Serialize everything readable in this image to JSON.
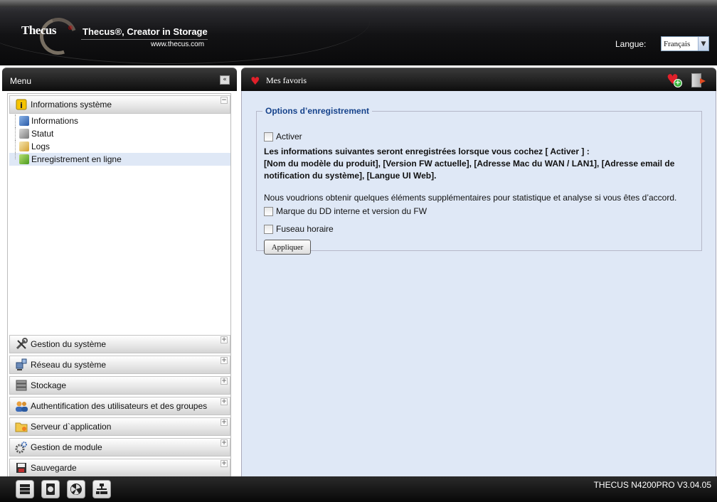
{
  "header": {
    "logo_text": "Thecus",
    "logo_reg": "®",
    "tagline": "Thecus®, Creator in Storage",
    "website": "www.thecus.com",
    "language_label": "Langue:",
    "language_value": "Français"
  },
  "menu": {
    "title": "Menu",
    "collapse_label": "«",
    "expanded_section": {
      "label": "Informations système",
      "toggle": "−",
      "items": [
        {
          "label": "Informations"
        },
        {
          "label": "Statut"
        },
        {
          "label": "Logs"
        },
        {
          "label": "Enregistrement en ligne",
          "selected": true
        }
      ]
    },
    "sections": [
      {
        "label": "Gestion du système",
        "toggle": "+",
        "icon": "tools-icon"
      },
      {
        "label": "Réseau du système",
        "toggle": "+",
        "icon": "network-icon"
      },
      {
        "label": "Stockage",
        "toggle": "+",
        "icon": "storage-icon"
      },
      {
        "label": "Authentification des utilisateurs et des groupes",
        "toggle": "+",
        "icon": "users-icon"
      },
      {
        "label": "Serveur d`application",
        "toggle": "+",
        "icon": "folder-server-icon"
      },
      {
        "label": "Gestion de module",
        "toggle": "+",
        "icon": "gears-icon"
      },
      {
        "label": "Sauvegarde",
        "toggle": "+",
        "icon": "backup-icon"
      }
    ]
  },
  "favorites": {
    "title": "Mes favoris"
  },
  "form": {
    "legend": "Options d’enregistrement",
    "activate_label": "Activer",
    "bold_text_1": "Les informations suivantes seront enregistrées lorsque vous cochez [ Activer ] :",
    "bold_text_2": "[Nom du modèle du produit], [Version FW actuelle], [Adresse Mac du WAN / LAN1], [Adresse email de notification du système], [Langue UI Web].",
    "extra_text": "Nous voudrions obtenir quelques éléments supplémentaires pour statistique et analyse si vous êtes d’accord.",
    "hdd_label": "Marque du DD interne et version du FW",
    "timezone_label": "Fuseau horaire",
    "apply_label": "Appliquer"
  },
  "footer": {
    "version": "THECUS N4200PRO V3.04.05"
  },
  "colors": {
    "content_bg": "#dfe8f6",
    "legend_color": "#15428b",
    "selected_row": "#dfe8f6"
  }
}
